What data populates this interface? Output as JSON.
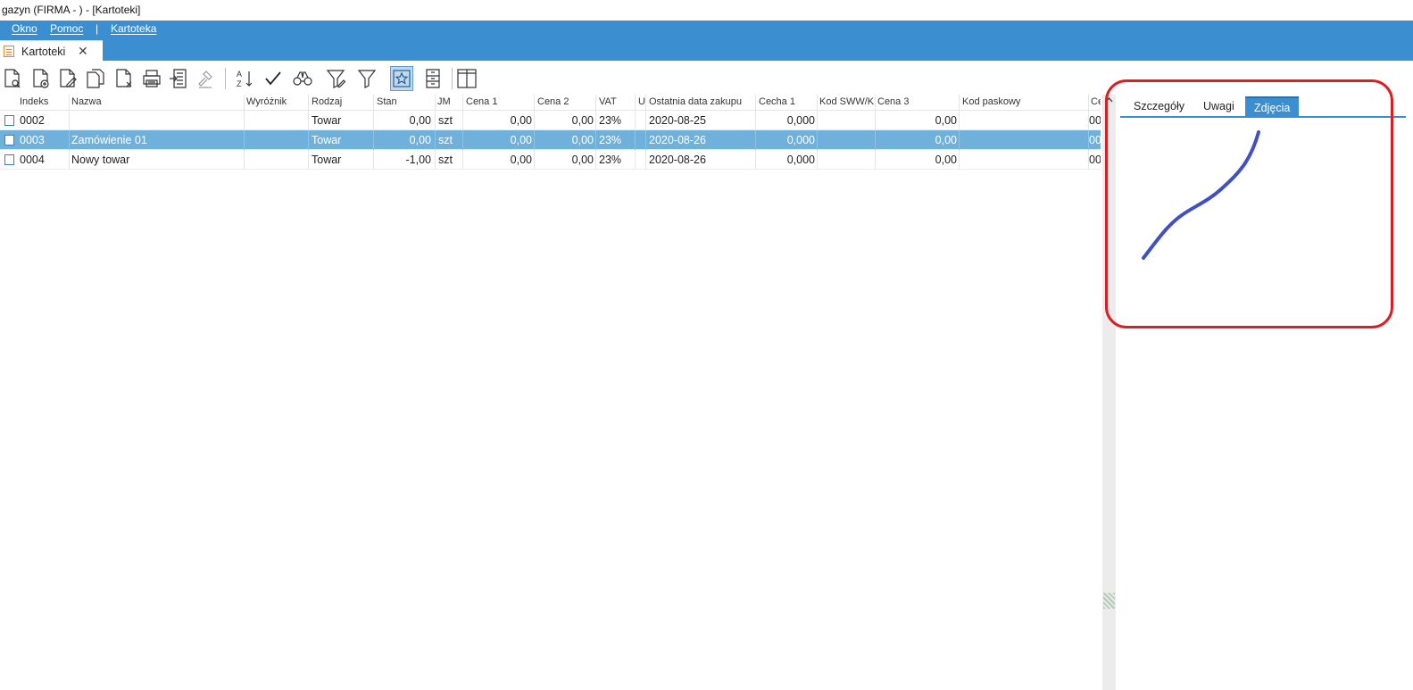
{
  "window": {
    "title": "gazyn (FIRMA - ) - [Kartoteki]"
  },
  "menu": {
    "okno": "Okno",
    "pomoc": "Pomoc",
    "separator": "|",
    "kartoteka": "Kartoteka"
  },
  "tab": {
    "label": "Kartoteki",
    "close": "✕"
  },
  "toolbar": {
    "buttons": [
      "preview-icon",
      "add-document-icon",
      "edit-document-icon",
      "copy-document-icon",
      "delete-document-icon",
      "print-icon",
      "export-icon",
      "hammer-icon",
      "sort-az-icon",
      "checkmark-icon",
      "binoculars-icon",
      "filter-edit-icon",
      "filter-icon",
      "favorite-star-icon",
      "cabinet-icon",
      "columns-icon"
    ],
    "active_button": "favorite-star-icon",
    "sort_label_top": "A",
    "sort_label_bottom": "Z"
  },
  "grid": {
    "columns": [
      "Indeks",
      "Nazwa",
      "Wyróżnik",
      "Rodzaj",
      "Stan",
      "JM",
      "Cena 1",
      "Cena 2",
      "VAT",
      "U",
      "Ostatnia data zakupu",
      "Cecha 1",
      "Kod SWW/K",
      "Cena 3",
      "Kod paskowy",
      "Ce"
    ],
    "rows": [
      {
        "indeks": "0002",
        "nazwa": "",
        "wyroznik": "",
        "rodzaj": "Towar",
        "stan": "0,00",
        "jm": "szt",
        "cena1": "0,00",
        "cena2": "0,00",
        "vat": "23%",
        "u": "",
        "data": "2020-08-25",
        "cecha1": "0,000",
        "sww": "",
        "cena3": "0,00",
        "kod": "",
        "ce": "00"
      },
      {
        "indeks": "0003",
        "nazwa": "Zamówienie 01",
        "wyroznik": "",
        "rodzaj": "Towar",
        "stan": "0,00",
        "jm": "szt",
        "cena1": "0,00",
        "cena2": "0,00",
        "vat": "23%",
        "u": "",
        "data": "2020-08-26",
        "cecha1": "0,000",
        "sww": "",
        "cena3": "0,00",
        "kod": "",
        "ce": "00"
      },
      {
        "indeks": "0004",
        "nazwa": "Nowy towar",
        "wyroznik": "",
        "rodzaj": "Towar",
        "stan": "-1,00",
        "jm": "szt",
        "cena1": "0,00",
        "cena2": "0,00",
        "vat": "23%",
        "u": "",
        "data": "2020-08-26",
        "cecha1": "0,000",
        "sww": "",
        "cena3": "0,00",
        "kod": "",
        "ce": "00"
      }
    ],
    "selected_row": 1
  },
  "details": {
    "tabs": [
      "Szczegóły",
      "Uwagi",
      "Zdjęcia"
    ],
    "active_tab": "Zdjęcia"
  },
  "colors": {
    "accent": "#3b8fd0",
    "selection": "#70b1dc",
    "highlight_box": "#e01b22",
    "stroke": "#3f4fc4"
  }
}
